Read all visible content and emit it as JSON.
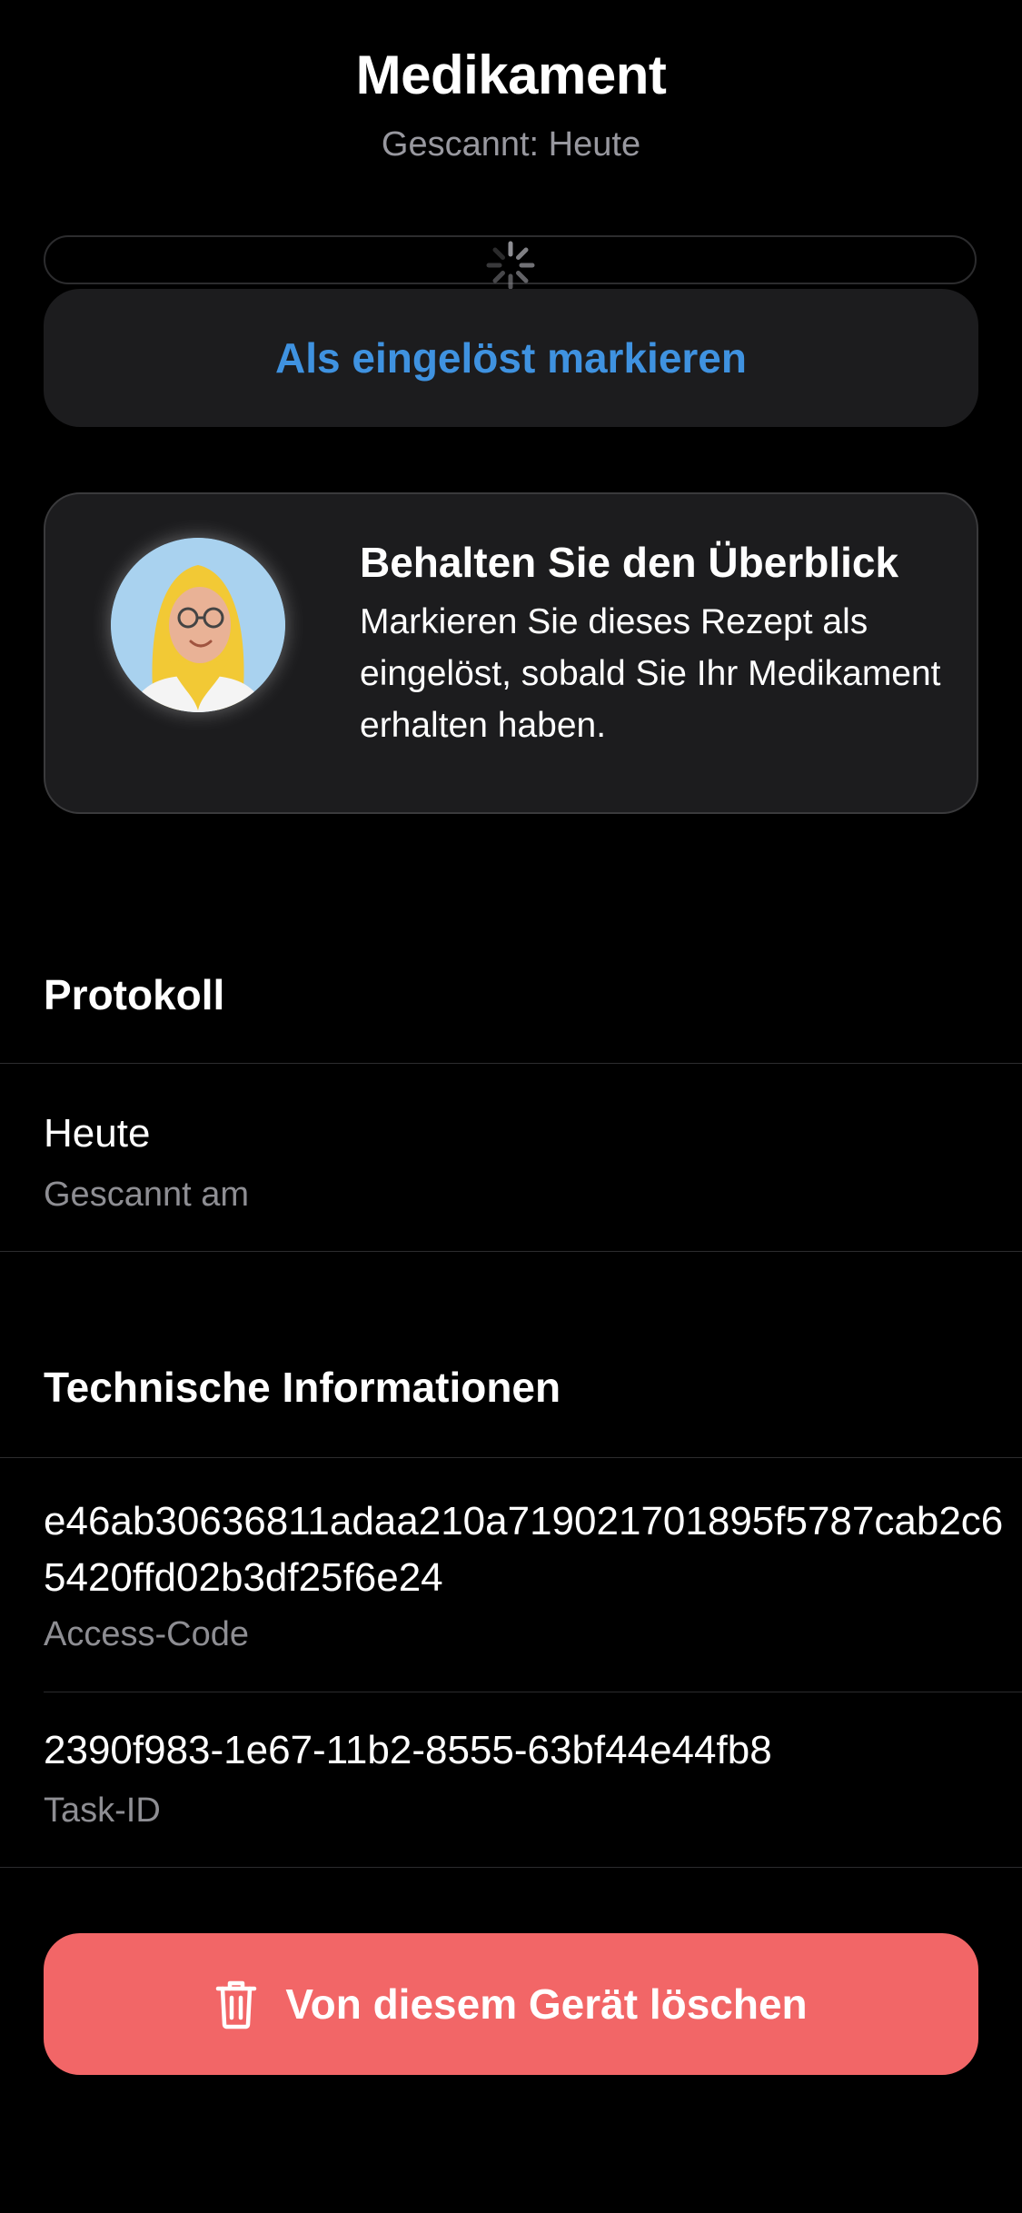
{
  "header": {
    "title": "Medikament",
    "subtitle": "Gescannt: Heute"
  },
  "actions": {
    "mark_redeemed_label": "Als eingelöst markieren",
    "delete_label": "Von diesem Gerät löschen"
  },
  "info_card": {
    "title": "Behalten Sie den Überblick",
    "text": "Markieren Sie dieses Rezept als eingelöst, sobald Sie Ihr Medikament erhalten haben."
  },
  "protocol": {
    "header": "Protokoll",
    "entries": [
      {
        "value": "Heute",
        "label": "Gescannt am"
      }
    ]
  },
  "technical": {
    "header": "Technische Informationen",
    "access_code": {
      "value": "e46ab30636811adaa210a719021701895f5787cab2c65420ffd02b3df25f6e24",
      "label": "Access-Code"
    },
    "task_id": {
      "value": "2390f983-1e67-11b2-8555-63bf44e44fb8",
      "label": "Task-ID"
    }
  },
  "icons": {
    "loading": "loading-spinner-icon",
    "avatar": "pharmacist-avatar",
    "delete": "trash-icon"
  },
  "colors": {
    "accent": "#3f92e0",
    "destructive": "#f26667",
    "card_background": "#1c1c1e",
    "secondary_text": "#8e8e93"
  }
}
